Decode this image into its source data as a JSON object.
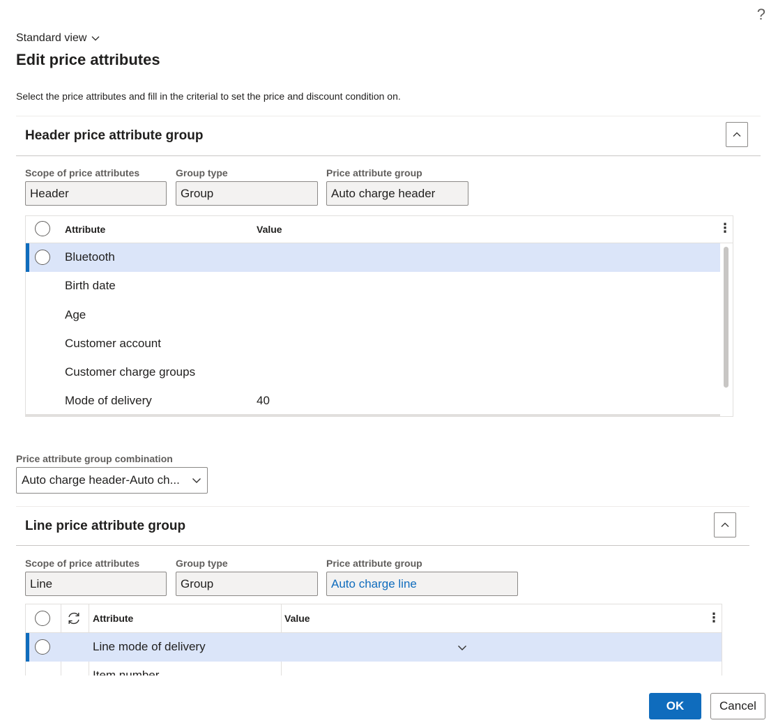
{
  "help_icon": "?",
  "view": {
    "label": "Standard view"
  },
  "page": {
    "title": "Edit price attributes",
    "description": "Select the price attributes and fill in the criterial to set the price and discount condition on."
  },
  "header_section": {
    "title": "Header price attribute group",
    "fields": {
      "scope_label": "Scope of price attributes",
      "scope_value": "Header",
      "group_type_label": "Group type",
      "group_type_value": "Group",
      "price_group_label": "Price attribute group",
      "price_group_value": "Auto charge header"
    },
    "grid": {
      "columns": [
        "Attribute",
        "Value"
      ],
      "rows": [
        {
          "attribute": "Bluetooth",
          "value": "",
          "selected": true
        },
        {
          "attribute": "Birth date",
          "value": ""
        },
        {
          "attribute": "Age",
          "value": ""
        },
        {
          "attribute": "Customer account",
          "value": ""
        },
        {
          "attribute": "Customer charge groups",
          "value": ""
        },
        {
          "attribute": "Mode of delivery",
          "value": "40"
        }
      ]
    }
  },
  "combination": {
    "label": "Price attribute group combination",
    "value": "Auto charge header-Auto ch..."
  },
  "line_section": {
    "title": "Line price attribute group",
    "fields": {
      "scope_label": "Scope of price attributes",
      "scope_value": "Line",
      "group_type_label": "Group type",
      "group_type_value": "Group",
      "price_group_label": "Price attribute group",
      "price_group_value": "Auto charge line"
    },
    "grid": {
      "columns": [
        "Attribute",
        "Value"
      ],
      "rows": [
        {
          "attribute": "Line mode of delivery",
          "value": "",
          "selected": true
        },
        {
          "attribute": "Item number",
          "value": ""
        }
      ]
    }
  },
  "footer": {
    "ok_label": "OK",
    "cancel_label": "Cancel"
  },
  "colors": {
    "accent": "#0f6cbd",
    "selected_row": "#dbe5f9",
    "field_bg": "#f3f2f1"
  }
}
